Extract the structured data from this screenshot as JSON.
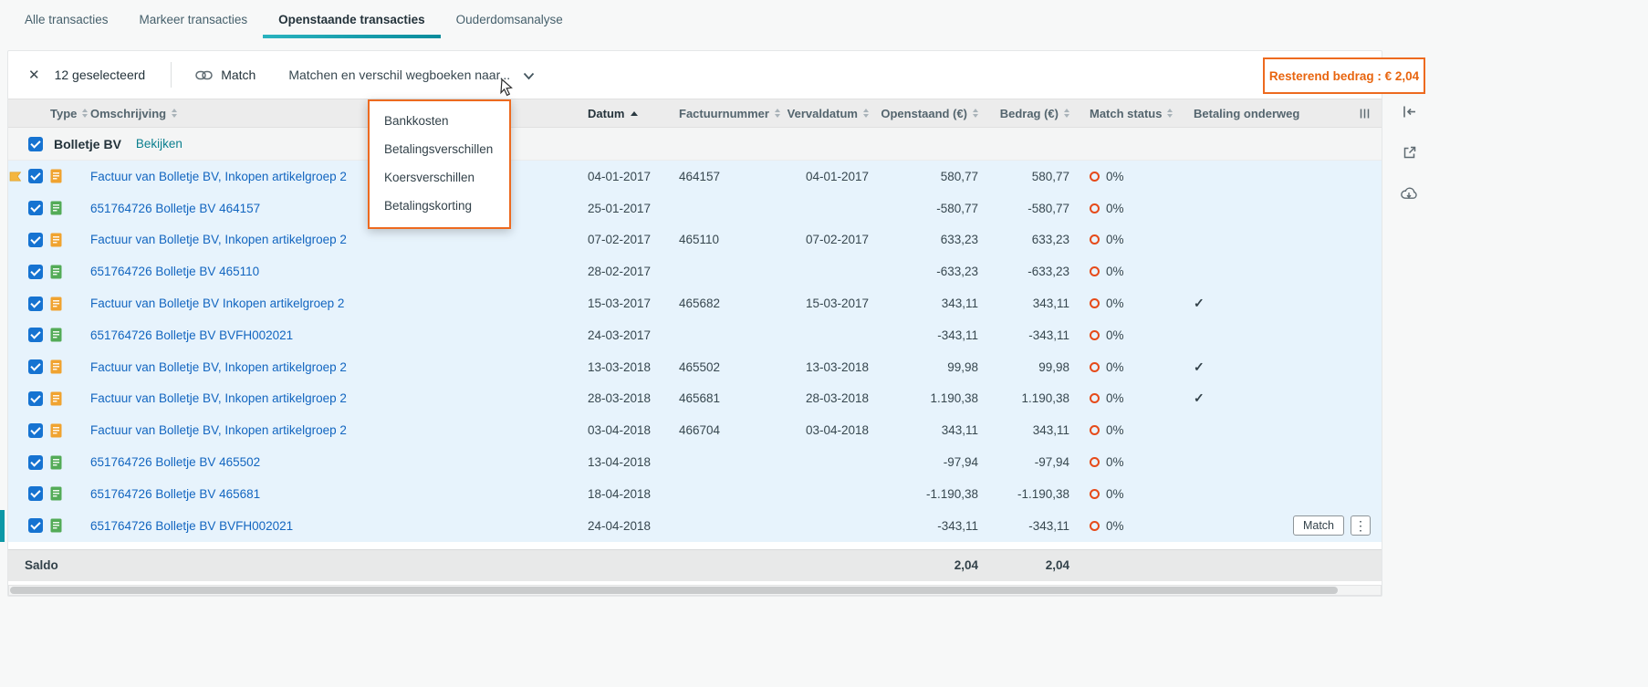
{
  "colors": {
    "accent_teal": "#0d98a6",
    "accent_orange": "#ed6a1f",
    "link_blue": "#1366c0",
    "selection_blue": "#e7f3fc",
    "checkbox_blue": "#1673d1",
    "match_ring": "#e64a19"
  },
  "icons": {
    "close": "✕",
    "kebab": "⋮",
    "check": "✓"
  },
  "tabs": [
    {
      "label": "Alle transacties",
      "active": false
    },
    {
      "label": "Markeer transacties",
      "active": false
    },
    {
      "label": "Openstaande transacties",
      "active": true
    },
    {
      "label": "Ouderdomsanalyse",
      "active": false
    }
  ],
  "toolbar": {
    "selected_count": "12 geselecteerd",
    "match_label": "Match",
    "writeoff_dropdown_label": "Matchen en verschil wegboeken naar...",
    "remaining_amount_label": "Resterend bedrag : € 2,04"
  },
  "writeoff_menu": {
    "items": [
      "Bankkosten",
      "Betalingsverschillen",
      "Koersverschillen",
      "Betalingskorting"
    ]
  },
  "table": {
    "columns": [
      "Type",
      "Omschrijving",
      "Datum",
      "Factuurnummer",
      "Vervaldatum",
      "Openstaand (€)",
      "Bedrag (€)",
      "Match status",
      "Betaling onderweg"
    ],
    "sorted_column": "Datum",
    "sort_direction": "asc",
    "group": {
      "name": "Bolletje BV",
      "action_label": "Bekijken"
    },
    "row_match_label": "Match",
    "rows": [
      {
        "flag": true,
        "type": "invoice",
        "description": "Factuur van Bolletje BV, Inkopen artikelgroep 2",
        "date": "04-01-2017",
        "invoice_number": "464157",
        "due_date": "04-01-2017",
        "outstanding": "580,77",
        "amount": "580,77",
        "match_status": "0%",
        "payment_in_transit": false,
        "actions": false
      },
      {
        "flag": false,
        "type": "payment",
        "description": "651764726 Bolletje BV 464157",
        "date": "25-01-2017",
        "invoice_number": "",
        "due_date": "",
        "outstanding": "-580,77",
        "amount": "-580,77",
        "match_status": "0%",
        "payment_in_transit": false,
        "actions": false
      },
      {
        "flag": false,
        "type": "invoice",
        "description": "Factuur van Bolletje BV, Inkopen artikelgroep 2",
        "date": "07-02-2017",
        "invoice_number": "465110",
        "due_date": "07-02-2017",
        "outstanding": "633,23",
        "amount": "633,23",
        "match_status": "0%",
        "payment_in_transit": false,
        "actions": false
      },
      {
        "flag": false,
        "type": "payment",
        "description": "651764726 Bolletje BV 465110",
        "date": "28-02-2017",
        "invoice_number": "",
        "due_date": "",
        "outstanding": "-633,23",
        "amount": "-633,23",
        "match_status": "0%",
        "payment_in_transit": false,
        "actions": false
      },
      {
        "flag": false,
        "type": "invoice",
        "description": "Factuur van Bolletje BV Inkopen artikelgroep 2",
        "date": "15-03-2017",
        "invoice_number": "465682",
        "due_date": "15-03-2017",
        "outstanding": "343,11",
        "amount": "343,11",
        "match_status": "0%",
        "payment_in_transit": true,
        "actions": false
      },
      {
        "flag": false,
        "type": "payment",
        "description": "651764726 Bolletje BV BVFH002021",
        "date": "24-03-2017",
        "invoice_number": "",
        "due_date": "",
        "outstanding": "-343,11",
        "amount": "-343,11",
        "match_status": "0%",
        "payment_in_transit": false,
        "actions": false
      },
      {
        "flag": false,
        "type": "invoice",
        "description": "Factuur van Bolletje BV, Inkopen artikelgroep 2",
        "date": "13-03-2018",
        "invoice_number": "465502",
        "due_date": "13-03-2018",
        "outstanding": "99,98",
        "amount": "99,98",
        "match_status": "0%",
        "payment_in_transit": true,
        "actions": false
      },
      {
        "flag": false,
        "type": "invoice",
        "description": "Factuur van Bolletje BV, Inkopen artikelgroep 2",
        "date": "28-03-2018",
        "invoice_number": "465681",
        "due_date": "28-03-2018",
        "outstanding": "1.190,38",
        "amount": "1.190,38",
        "match_status": "0%",
        "payment_in_transit": true,
        "actions": false
      },
      {
        "flag": false,
        "type": "invoice",
        "description": "Factuur van Bolletje BV, Inkopen artikelgroep 2",
        "date": "03-04-2018",
        "invoice_number": "466704",
        "due_date": "03-04-2018",
        "outstanding": "343,11",
        "amount": "343,11",
        "match_status": "0%",
        "payment_in_transit": false,
        "actions": false
      },
      {
        "flag": false,
        "type": "payment",
        "description": "651764726 Bolletje BV 465502",
        "date": "13-04-2018",
        "invoice_number": "",
        "due_date": "",
        "outstanding": "-97,94",
        "amount": "-97,94",
        "match_status": "0%",
        "payment_in_transit": false,
        "actions": false
      },
      {
        "flag": false,
        "type": "payment",
        "description": "651764726 Bolletje BV 465681",
        "date": "18-04-2018",
        "invoice_number": "",
        "due_date": "",
        "outstanding": "-1.190,38",
        "amount": "-1.190,38",
        "match_status": "0%",
        "payment_in_transit": false,
        "actions": false
      },
      {
        "flag": false,
        "type": "payment",
        "description": "651764726 Bolletje BV BVFH002021",
        "date": "24-04-2018",
        "invoice_number": "",
        "due_date": "",
        "outstanding": "-343,11",
        "amount": "-343,11",
        "match_status": "0%",
        "payment_in_transit": false,
        "actions": true
      }
    ],
    "footer": {
      "label": "Saldo",
      "outstanding": "2,04",
      "amount": "2,04"
    }
  }
}
